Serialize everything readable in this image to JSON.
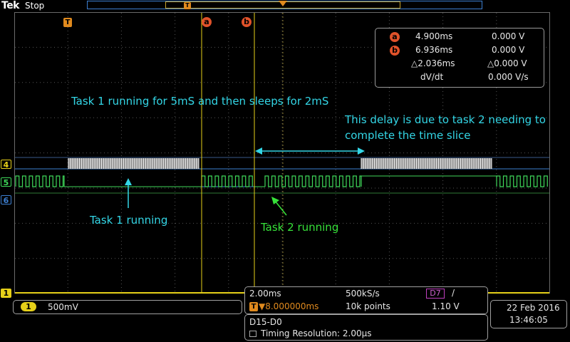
{
  "header": {
    "brand": "Tek",
    "acquisition_state": "Stop",
    "trigger_marker": "T",
    "cursor_a_marker": "a",
    "cursor_b_marker": "b"
  },
  "cursor_readout": {
    "a_label": "a",
    "a_time": "4.900ms",
    "a_value": "0.000 V",
    "b_label": "b",
    "b_time": "6.936ms",
    "b_value": "0.000 V",
    "delta_time": "△2.036ms",
    "delta_value": "△0.000 V",
    "slope_label": "dV/dt",
    "slope_value": "0.000 V/s"
  },
  "annotations": {
    "task1_sleep": "Task 1 running for 5mS and then sleeps for 2mS",
    "delay_line1": "This delay is due to task 2 needing to",
    "delay_line2": "complete the time slice",
    "task1_running": "Task 1 running",
    "task2_running": "Task 2 running"
  },
  "channels": {
    "d4": "4",
    "d5": "5",
    "d6": "6",
    "analog1": "1"
  },
  "channel1_panel": {
    "badge": "1",
    "scale": "500mV"
  },
  "horizontal_panel": {
    "timebase": "2.00ms",
    "sample_rate": "500kS/s",
    "trigger_badge": "T",
    "trigger_position": "▼8.000000ms",
    "record_length": "10k points"
  },
  "trigger_panel": {
    "source": "D7",
    "slope": "/",
    "level": "1.10 V"
  },
  "bus_panel": {
    "bus": "D15-D0",
    "timing_label": "Timing Resolution: 2.00µs"
  },
  "datetime": {
    "date": "22 Feb  2016",
    "time": "13:46:05"
  },
  "colors": {
    "d4": "#c8c8c8",
    "d5": "#3fd85a",
    "d6": "#3d7fd0",
    "ch1": "#e6d019",
    "cursor": "#e6d019",
    "annotation_cyan": "#33d6e6",
    "annotation_green": "#37e23a"
  }
}
